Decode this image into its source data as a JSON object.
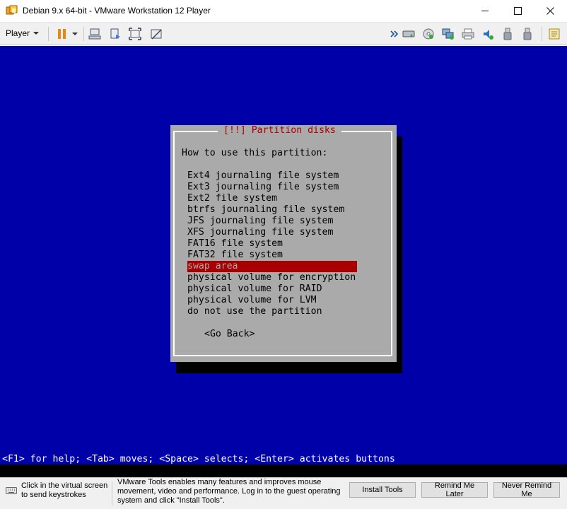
{
  "window": {
    "title": "Debian 9.x 64-bit - VMware Workstation 12 Player",
    "minimize": "—",
    "maximize": "☐",
    "close": "✕"
  },
  "toolbar": {
    "player_label": "Player",
    "icons": [
      "pause-icon",
      "send-ctrl-alt-del-icon",
      "snapshot-icon",
      "fullscreen-icon",
      "unity-icon",
      "expand-arrow-icon",
      "hard-disk-icon",
      "cd-dvd-icon",
      "network-adapter-icon",
      "printer-icon",
      "sound-card-icon",
      "usb-device-icon",
      "usb-device-icon-2",
      "message-log-icon"
    ]
  },
  "installer": {
    "title": "[!!] Partition disks",
    "prompt": "How to use this partition:",
    "options": [
      "Ext4 journaling file system",
      "Ext3 journaling file system",
      "Ext2 file system",
      "btrfs journaling file system",
      "JFS journaling file system",
      "XFS journaling file system",
      "FAT16 file system",
      "FAT32 file system",
      "swap area",
      "physical volume for encryption",
      "physical volume for RAID",
      "physical volume for LVM",
      "do not use the partition"
    ],
    "selected_option": "swap area",
    "go_back": "<Go Back>",
    "help_line": "<F1> for help; <Tab> moves; <Space> selects; <Enter> activates buttons"
  },
  "notification": {
    "hint_line1": "Click in the virtual screen",
    "hint_line2": "to send keystrokes",
    "message": "VMware Tools enables many features and improves mouse movement, video and performance. Log in to the guest operating system and click \"Install Tools\".",
    "install_button": "Install Tools",
    "remind_button": "Remind Me Later",
    "never_button": "Never Remind Me"
  },
  "colors": {
    "vm_background": "#0000a8",
    "dialog_background": "#aaaaaa",
    "title_red": "#a80000",
    "selection_red": "#a80000"
  }
}
